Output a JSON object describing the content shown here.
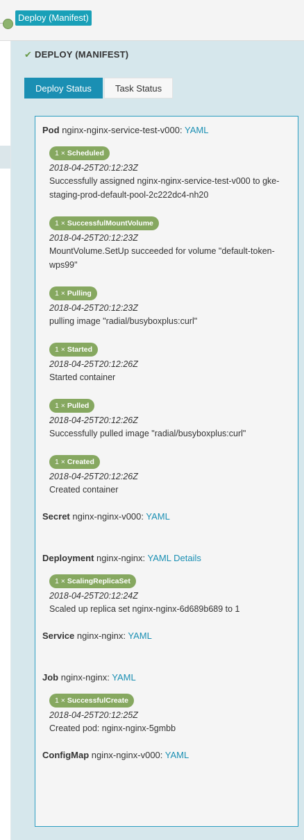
{
  "pipeline": {
    "stage_label": "Deploy (Manifest)"
  },
  "detail": {
    "title": "DEPLOY (MANIFEST)",
    "tabs": [
      {
        "label": "Deploy Status"
      },
      {
        "label": "Task Status"
      }
    ]
  },
  "resources": {
    "pod": {
      "kind": "Pod",
      "name": "nginx-nginx-service-test-v000:",
      "link": "YAML",
      "events": [
        {
          "count": "1 ×",
          "reason": "Scheduled",
          "time": "2018-04-25T20:12:23Z",
          "msg1": "Successfully assigned nginx-nginx-service-test-v000 to gke-",
          "msg2": "staging-prod-default-pool-2c222dc4-nh20"
        },
        {
          "count": "1 ×",
          "reason": "SuccessfulMountVolume",
          "time": "2018-04-25T20:12:23Z",
          "msg1": "MountVolume.SetUp succeeded for volume \"default-token-",
          "msg2": "wps99\""
        },
        {
          "count": "1 ×",
          "reason": "Pulling",
          "time": "2018-04-25T20:12:23Z",
          "msg1": "pulling image \"radial/busyboxplus:curl\""
        },
        {
          "count": "1 ×",
          "reason": "Started",
          "time": "2018-04-25T20:12:26Z",
          "msg1": "Started container"
        },
        {
          "count": "1 ×",
          "reason": "Pulled",
          "time": "2018-04-25T20:12:26Z",
          "msg1": "Successfully pulled image \"radial/busyboxplus:curl\""
        },
        {
          "count": "1 ×",
          "reason": "Created",
          "time": "2018-04-25T20:12:26Z",
          "msg1": "Created container"
        }
      ]
    },
    "secret": {
      "kind": "Secret",
      "name": "nginx-nginx-v000:",
      "link": "YAML"
    },
    "deployment": {
      "kind": "Deployment",
      "name": "nginx-nginx:",
      "link": "YAML",
      "link2": "Details",
      "events": [
        {
          "count": "1 ×",
          "reason": "ScalingReplicaSet",
          "time": "2018-04-25T20:12:24Z",
          "msg1": "Scaled up replica set nginx-nginx-6d689b689 to 1"
        }
      ]
    },
    "service": {
      "kind": "Service",
      "name": "nginx-nginx:",
      "link": "YAML"
    },
    "job": {
      "kind": "Job",
      "name": "nginx-nginx:",
      "link": "YAML",
      "events": [
        {
          "count": "1 ×",
          "reason": "SuccessfulCreate",
          "time": "2018-04-25T20:12:25Z",
          "msg1": "Created pod: nginx-nginx-5gmbb"
        }
      ]
    },
    "configmap": {
      "kind": "ConfigMap",
      "name": "nginx-nginx-v000:",
      "link": "YAML"
    }
  },
  "colors": {
    "accent": "#1a8fb3",
    "badge": "#86a860",
    "panel": "#d6e7ec",
    "stage": "#19a0b8"
  }
}
